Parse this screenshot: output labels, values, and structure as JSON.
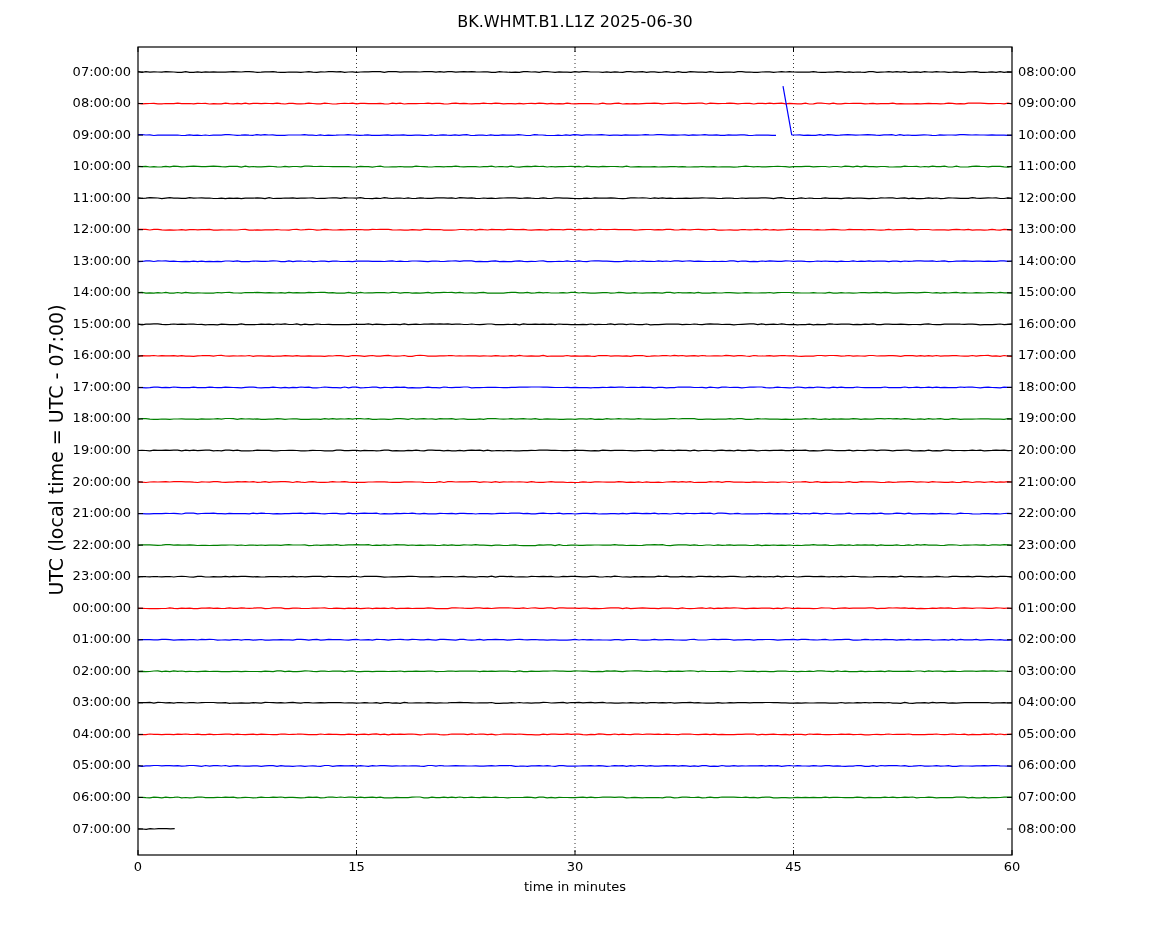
{
  "title": "BK.WHMT.B1.L1Z 2025-06-30",
  "y_axis_label": "UTC (local time = UTC - 07:00)",
  "x_axis_label": "time in minutes",
  "x_ticks": [
    "0",
    "15",
    "30",
    "45",
    "60"
  ],
  "rows": [
    {
      "left": "07:00:00",
      "right": "08:00:00",
      "color": "#000000",
      "kind": "trace"
    },
    {
      "left": "08:00:00",
      "right": "09:00:00",
      "color": "#ff0000",
      "kind": "trace"
    },
    {
      "left": "09:00:00",
      "right": "10:00:00",
      "color": "#0000ff",
      "kind": "glitch"
    },
    {
      "left": "10:00:00",
      "right": "11:00:00",
      "color": "#008000",
      "kind": "trace"
    },
    {
      "left": "11:00:00",
      "right": "12:00:00",
      "color": "#000000",
      "kind": "trace"
    },
    {
      "left": "12:00:00",
      "right": "13:00:00",
      "color": "#ff0000",
      "kind": "trace"
    },
    {
      "left": "13:00:00",
      "right": "14:00:00",
      "color": "#0000ff",
      "kind": "trace"
    },
    {
      "left": "14:00:00",
      "right": "15:00:00",
      "color": "#008000",
      "kind": "trace"
    },
    {
      "left": "15:00:00",
      "right": "16:00:00",
      "color": "#000000",
      "kind": "trace"
    },
    {
      "left": "16:00:00",
      "right": "17:00:00",
      "color": "#ff0000",
      "kind": "trace"
    },
    {
      "left": "17:00:00",
      "right": "18:00:00",
      "color": "#0000ff",
      "kind": "trace"
    },
    {
      "left": "18:00:00",
      "right": "19:00:00",
      "color": "#008000",
      "kind": "trace"
    },
    {
      "left": "19:00:00",
      "right": "20:00:00",
      "color": "#000000",
      "kind": "trace"
    },
    {
      "left": "20:00:00",
      "right": "21:00:00",
      "color": "#ff0000",
      "kind": "trace"
    },
    {
      "left": "21:00:00",
      "right": "22:00:00",
      "color": "#0000ff",
      "kind": "trace"
    },
    {
      "left": "22:00:00",
      "right": "23:00:00",
      "color": "#008000",
      "kind": "trace"
    },
    {
      "left": "23:00:00",
      "right": "00:00:00",
      "color": "#000000",
      "kind": "trace"
    },
    {
      "left": "00:00:00",
      "right": "01:00:00",
      "color": "#ff0000",
      "kind": "trace"
    },
    {
      "left": "01:00:00",
      "right": "02:00:00",
      "color": "#0000ff",
      "kind": "trace"
    },
    {
      "left": "02:00:00",
      "right": "03:00:00",
      "color": "#008000",
      "kind": "trace"
    },
    {
      "left": "03:00:00",
      "right": "04:00:00",
      "color": "#000000",
      "kind": "trace"
    },
    {
      "left": "04:00:00",
      "right": "05:00:00",
      "color": "#ff0000",
      "kind": "trace"
    },
    {
      "left": "05:00:00",
      "right": "06:00:00",
      "color": "#0000ff",
      "kind": "trace"
    },
    {
      "left": "06:00:00",
      "right": "07:00:00",
      "color": "#008000",
      "kind": "trace"
    },
    {
      "left": "07:00:00",
      "right": "08:00:00",
      "color": "#000000",
      "kind": "partial"
    }
  ]
}
